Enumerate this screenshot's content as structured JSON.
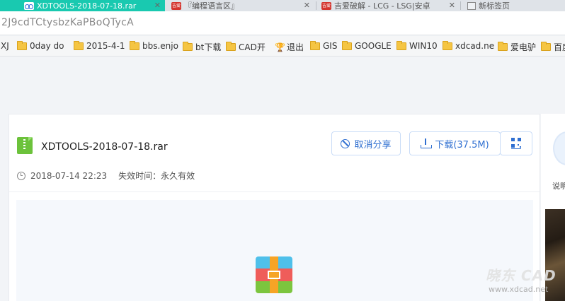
{
  "tabs": [
    {
      "title": "XDTOOLS-2018-07-18.rar",
      "active": true
    },
    {
      "title": "『编程语言区』"
    },
    {
      "title": "吉爱破解 - LCG - LSG|安卓"
    },
    {
      "title": "新标签页"
    }
  ],
  "favicon_badge": "吉爱",
  "address": "2J9cdTCtysbzKaPBoQTycA",
  "bookmarks": [
    {
      "label": "XJ",
      "icon": "none"
    },
    {
      "label": "0day do",
      "icon": "folder-icon"
    },
    {
      "label": "2015-4-1",
      "icon": "folder-icon"
    },
    {
      "label": "bbs.enjo",
      "icon": "folder-icon"
    },
    {
      "label": "bt下载",
      "icon": "folder-icon"
    },
    {
      "label": "CAD开",
      "icon": "folder-icon"
    },
    {
      "label": "退出",
      "icon": "trophy-icon"
    },
    {
      "label": "GIS",
      "icon": "folder-icon"
    },
    {
      "label": "GOOGLE",
      "icon": "folder-icon"
    },
    {
      "label": "WIN10",
      "icon": "folder-icon"
    },
    {
      "label": "xdcad.ne",
      "icon": "folder-icon"
    },
    {
      "label": "爱电驴",
      "icon": "folder-icon"
    },
    {
      "label": "百度",
      "icon": "folder-icon"
    }
  ],
  "file": {
    "name": "XDTOOLS-2018-07-18.rar",
    "date": "2018-07-14 22:23",
    "expiry": "失效时间：永久有效"
  },
  "buttons": {
    "cancel_share": "取消分享",
    "download": "下载(37.5M)"
  },
  "side": {
    "label": "说明"
  },
  "watermark": {
    "logo": "晓东 CAD",
    "url": "www.xdcad.net"
  },
  "colors": {
    "accent": "#2f6fd1",
    "active_tab": "#19c9b0",
    "file_icon": "#6cc23b"
  }
}
